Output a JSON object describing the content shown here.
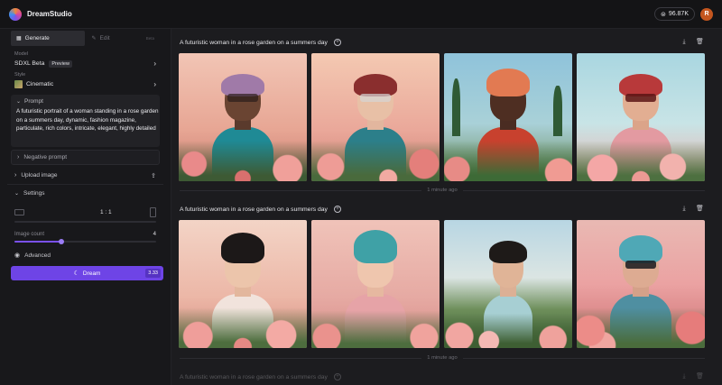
{
  "app": {
    "name": "DreamStudio",
    "credits": "96.87K",
    "avatar_initial": "R"
  },
  "sidebar": {
    "tabs": {
      "generate": "Generate",
      "edit": "Edit",
      "edit_hint": "Beta"
    },
    "model": {
      "label": "Model",
      "value": "SDXL Beta",
      "badge": "Preview"
    },
    "style": {
      "label": "Style",
      "value": "Cinematic"
    },
    "prompt": {
      "label": "Prompt",
      "text": "A futuristic portrait of a woman standing in a rose garden on a summers day, dynamic, fashion magazine, particulate, rich colors, intricate, elegant, highly detailed"
    },
    "negative_prompt": "Negative prompt",
    "upload_image": "Upload image",
    "settings": "Settings",
    "aspect_ratio": "1 : 1",
    "image_count": {
      "label": "Image count",
      "value": "4",
      "fraction": 0.33
    },
    "advanced": "Advanced",
    "dream": {
      "label": "Dream",
      "cost": "3.33"
    }
  },
  "generations": [
    {
      "prompt": "A futuristic woman in a rose garden on a summers day",
      "time": "1 minute ago"
    },
    {
      "prompt": "A futuristic woman in a rose garden on a summers day",
      "time": "1 minute ago"
    },
    {
      "prompt": "A futuristic woman in a rose garden on a summers day",
      "time": ""
    }
  ],
  "icons": {
    "logo": "dreamstudio-logo-icon",
    "credits": "coins-icon",
    "download": "download-icon",
    "delete": "trash-icon",
    "variation": "plus-circle-icon"
  }
}
